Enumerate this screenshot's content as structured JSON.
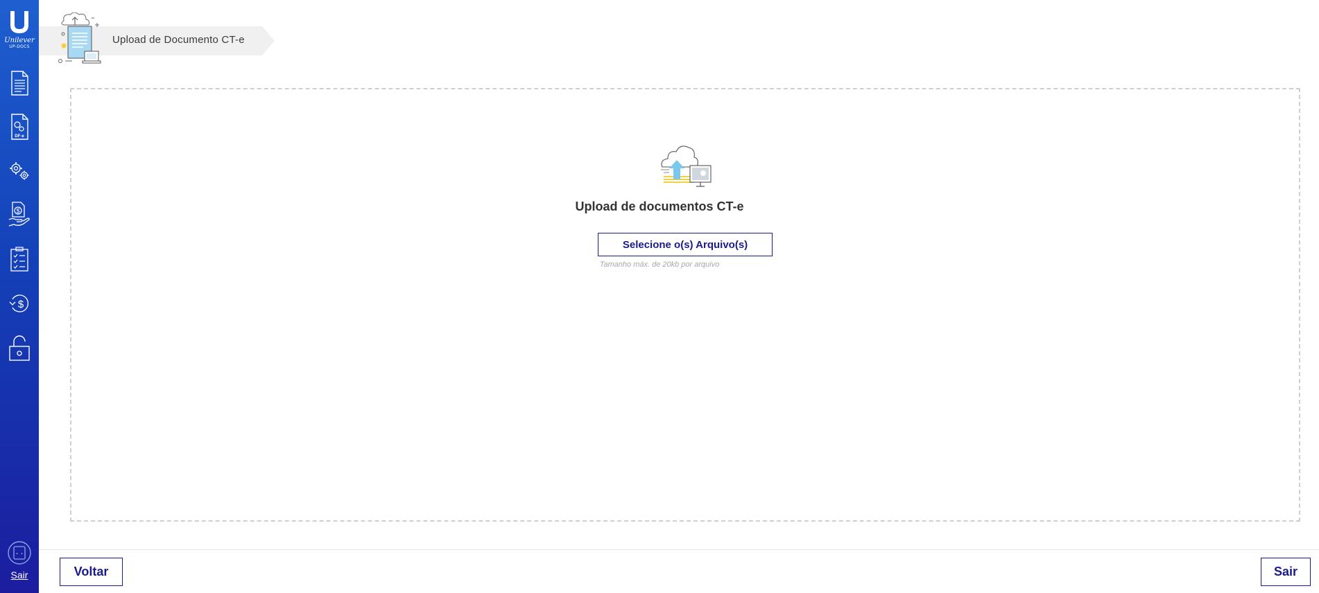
{
  "sidebar": {
    "brand_name": "Unilever",
    "brand_sub": "UP-DOCS",
    "nav_icons": [
      "document-icon",
      "dfe-document-icon",
      "gears-icon",
      "money-hand-icon",
      "checklist-icon",
      "refund-icon",
      "unlock-icon"
    ],
    "dfe_label": "DF-e",
    "logout_label": "Sair"
  },
  "header": {
    "title": "Upload de Documento CT-e"
  },
  "upload": {
    "heading": "Upload de documentos CT-e",
    "select_button_label": "Selecione o(s) Arquivo(s)",
    "size_hint": "Tamanho máx. de 20kb por arquivo"
  },
  "footer": {
    "back_label": "Voltar",
    "exit_label": "Sair"
  },
  "colors": {
    "sidebar_top": "#1e5fd0",
    "sidebar_bottom": "#1b1d9e",
    "accent": "#1a1a8c",
    "dashed_border": "#cfcfcf"
  }
}
